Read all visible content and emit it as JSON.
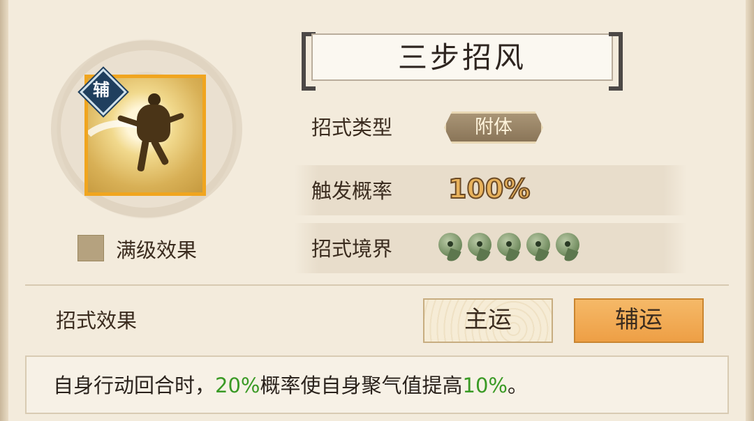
{
  "skill": {
    "name": "三步招风",
    "badge": "辅",
    "max_level_label": "满级效果"
  },
  "stats": {
    "type_label": "招式类型",
    "type_value": "附体",
    "rate_label": "触发概率",
    "rate_value": "100%",
    "realm_label": "招式境界",
    "realm_level": 5
  },
  "effect": {
    "title": "招式效果",
    "tabs": {
      "main": "主运",
      "assist": "辅运"
    },
    "active_tab": "assist",
    "desc_prefix": "自身行动回合时，",
    "desc_chance": "20%",
    "desc_middle": "概率使自身聚气值提高",
    "desc_amount": "10%",
    "desc_suffix": "。"
  },
  "colors": {
    "highlight_green": "#3a9a25",
    "active_tab": "#f0a54a",
    "icon_border": "#f0a51f"
  }
}
